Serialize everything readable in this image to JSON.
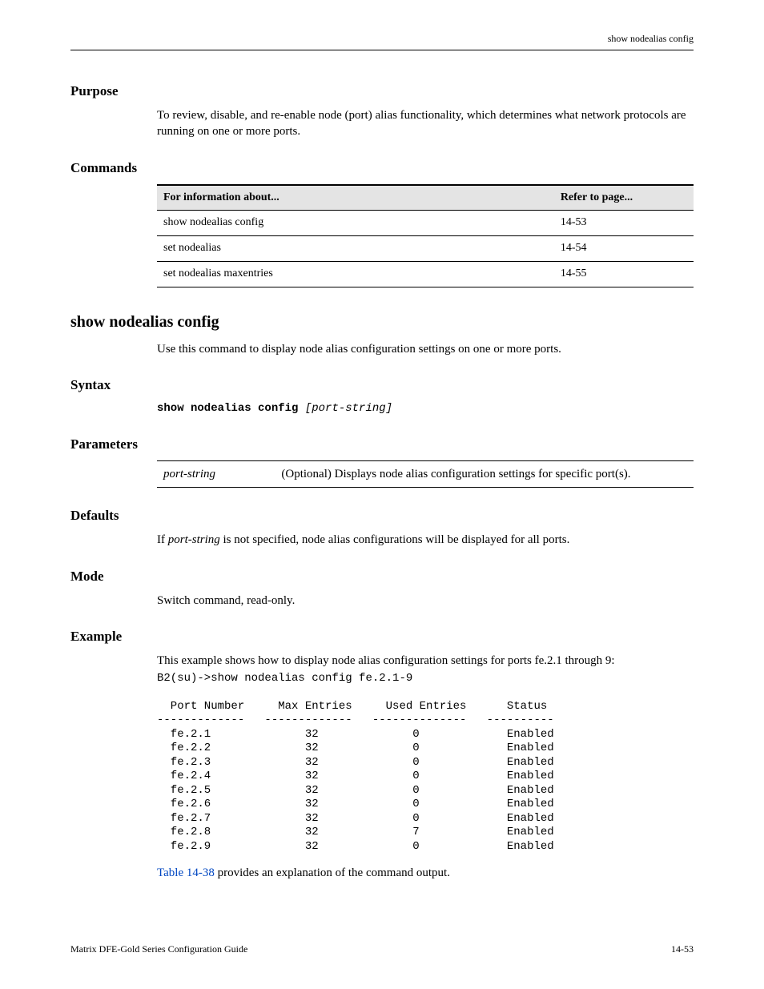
{
  "running_head": "show nodealias config",
  "purpose": {
    "heading": "Purpose",
    "text": "To review, disable, and re-enable node (port) alias functionality, which determines what network protocols are running on one or more ports."
  },
  "commands_heading": "Commands",
  "commands_table": {
    "headers": [
      "For information about...",
      "Refer to page..."
    ],
    "rows": [
      {
        "cmd": "show nodealias config",
        "page": "14-53"
      },
      {
        "cmd": "set nodealias",
        "page": "14-54"
      },
      {
        "cmd": "set nodealias maxentries",
        "page": "14-55"
      }
    ]
  },
  "cmd": {
    "name": "show nodealias config",
    "desc": "Use this command to display node alias configuration settings on one or more ports.",
    "syntax_heading": "Syntax",
    "syntax_literal": "show nodealias config",
    "syntax_opt": "[port-string]",
    "params_heading": "Parameters",
    "params": [
      {
        "name": "port-string",
        "desc": "(Optional) Displays node alias configuration settings for specific port(s)."
      }
    ],
    "defaults_heading": "Defaults",
    "defaults_text_pre": "If ",
    "defaults_text_var": "port-string",
    "defaults_text_post": " is not specified, node alias configurations will be displayed for all ports.",
    "mode_heading": "Mode",
    "mode_text": "Switch command, read-only.",
    "example_heading": "Example",
    "example_intro": "This example shows how to display node alias configuration settings for ports fe.2.1 through 9:",
    "example_output": "B2(su)->show nodealias config fe.2.1-9\n\n  Port Number     Max Entries     Used Entries      Status\n-------------   -------------   --------------   ----------\n  fe.2.1              32              0             Enabled\n  fe.2.2              32              0             Enabled\n  fe.2.3              32              0             Enabled\n  fe.2.4              32              0             Enabled\n  fe.2.5              32              0             Enabled\n  fe.2.6              32              0             Enabled\n  fe.2.7              32              0             Enabled\n  fe.2.8              32              7             Enabled\n  fe.2.9              32              0             Enabled",
    "outro_link": "Table 14-38",
    "outro_rest": " provides an explanation of the command output."
  },
  "footer": {
    "left": "Matrix DFE-Gold Series Configuration Guide",
    "right": "14-53"
  }
}
